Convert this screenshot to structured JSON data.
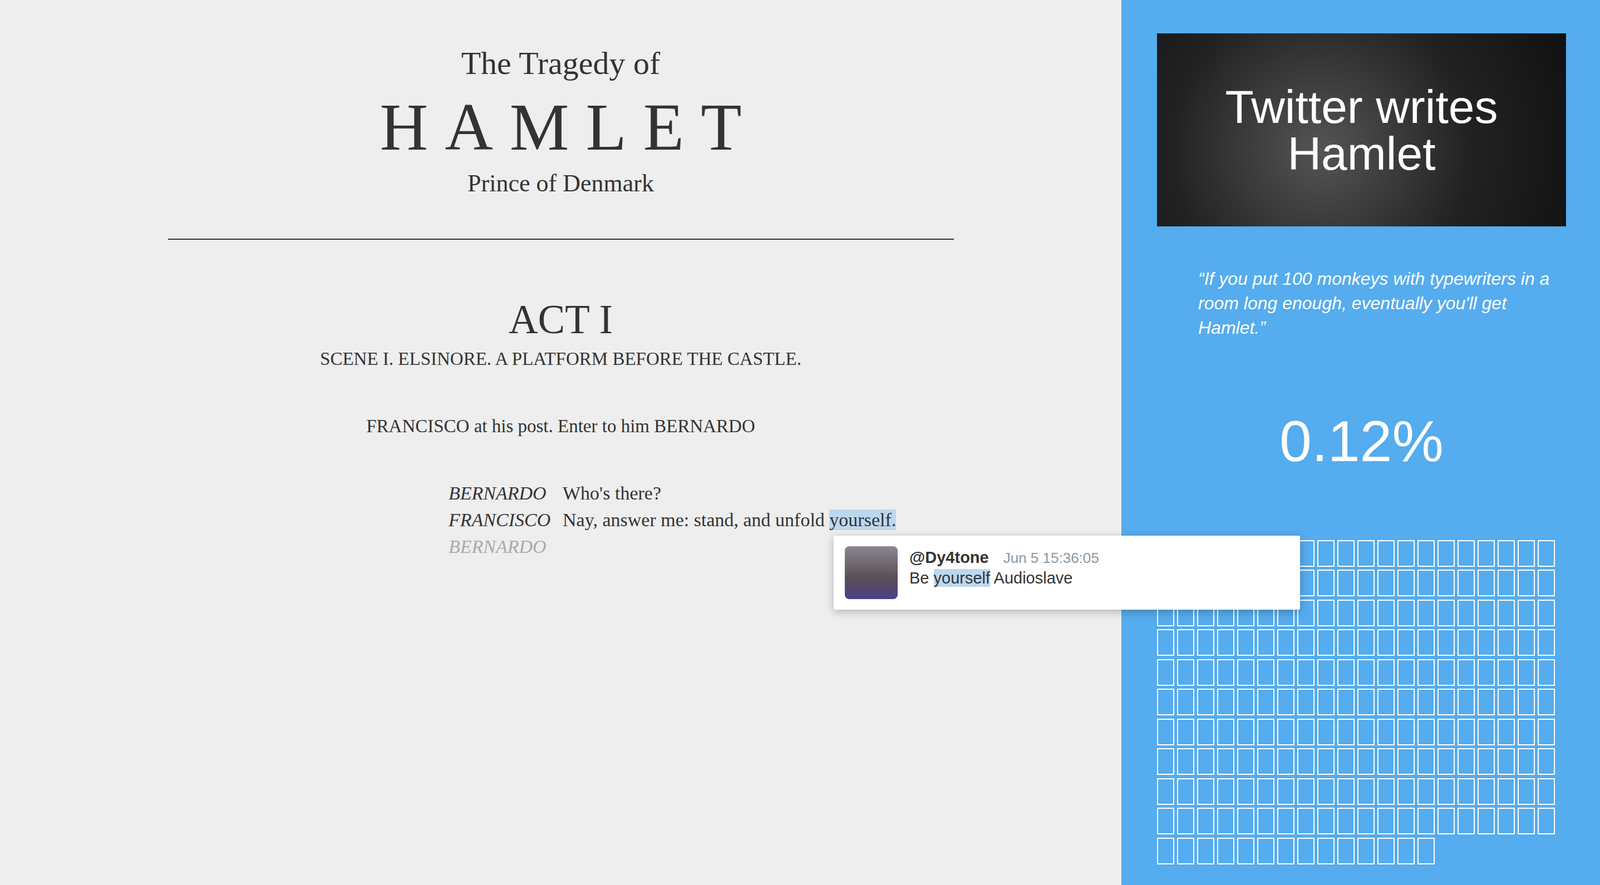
{
  "play": {
    "subtitle_top": "The Tragedy of",
    "title": "HAMLET",
    "subtitle_bottom": "Prince of Denmark",
    "act": "ACT I",
    "scene": "SCENE I. ELSINORE. A PLATFORM BEFORE THE CASTLE.",
    "stage_direction": "FRANCISCO at his post. Enter to him BERNARDO",
    "lines": [
      {
        "speaker": "BERNARDO",
        "pending": false,
        "segments": [
          {
            "text": "Who's there?",
            "highlighted": false
          }
        ]
      },
      {
        "speaker": "FRANCISCO",
        "pending": false,
        "segments": [
          {
            "text": "Nay, answer me: stand, and unfold ",
            "highlighted": false
          },
          {
            "text": "yourself.",
            "highlighted": true
          }
        ]
      },
      {
        "speaker": "BERNARDO",
        "pending": true,
        "segments": []
      }
    ]
  },
  "tweet": {
    "handle": "@Dy4tone",
    "time": "Jun 5 15:36:05",
    "segments": [
      {
        "text": "Be ",
        "highlighted": false
      },
      {
        "text": "yourself",
        "highlighted": true
      },
      {
        "text": " Audioslave",
        "highlighted": false
      }
    ]
  },
  "sidebar": {
    "banner": "Twitter writes Hamlet",
    "quote": "“If you put 100 monkeys with typewriters in a room long enough, eventually you'll get Hamlet.”",
    "progress": "0.12%",
    "word_grid": {
      "cells": 214,
      "filled": 0
    }
  }
}
